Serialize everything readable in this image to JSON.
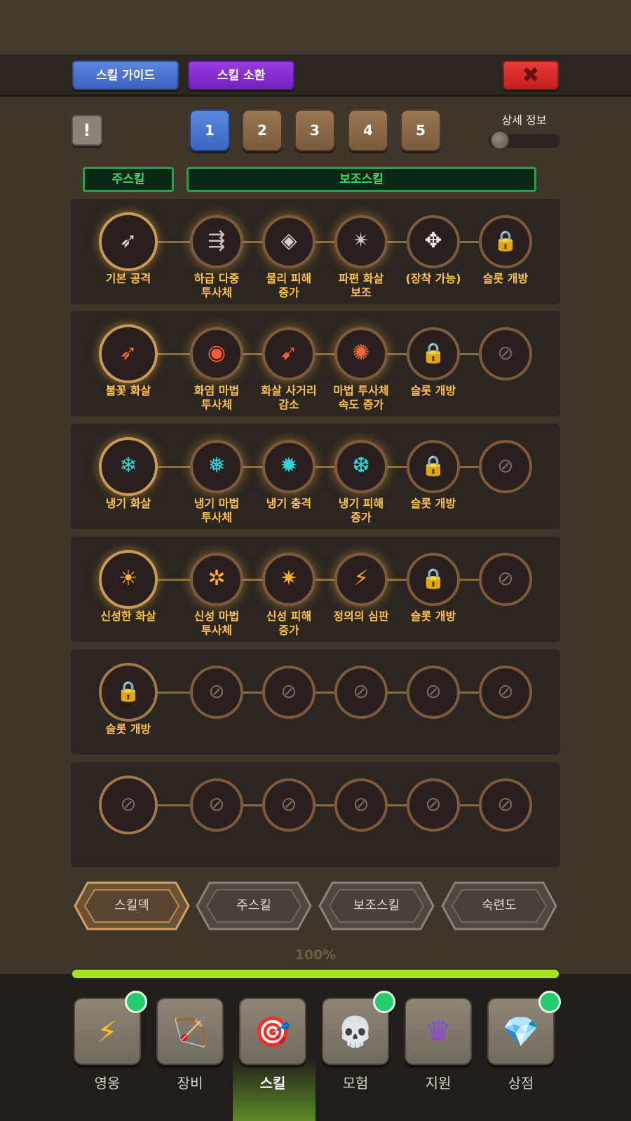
{
  "header": {
    "guide_label": "스킬 가이드",
    "summon_label": "스킬 소환",
    "close_symbol": "✖",
    "alert_symbol": "!",
    "colors": {
      "guide": "#4a75d4",
      "summon": "#8a2fd4",
      "close": "#d42828"
    }
  },
  "page_tabs": [
    "1",
    "2",
    "3",
    "4",
    "5"
  ],
  "active_page_tab": "1",
  "detail": {
    "label": "상세 정보",
    "toggle_on": false
  },
  "columns": {
    "main": "주스킬",
    "sub": "보조스킬"
  },
  "rows": [
    {
      "slots": [
        {
          "label": "기본 공격",
          "icon": "➶",
          "icon_name": "basic-arrow-icon",
          "color": "#dcd6cc"
        },
        {
          "label": "하급 다중\n투사체",
          "icon": "⇶",
          "icon_name": "multi-projectile-icon",
          "color": "#c9c2b8"
        },
        {
          "label": "물리 피해\n증가",
          "icon": "◈",
          "icon_name": "physical-damage-icon",
          "color": "#d7d0c6"
        },
        {
          "label": "파편 화살\n보조",
          "icon": "✴",
          "icon_name": "shrapnel-arrow-icon",
          "color": "#d0c9bf"
        },
        {
          "label": "(장착 가능)",
          "icon": "✥",
          "icon_name": "equip-move-icon",
          "color": "#f2ece2"
        },
        {
          "label": "슬롯 개방",
          "icon": "🔒",
          "icon_name": "lock-icon",
          "color": "#f2ece2"
        }
      ]
    },
    {
      "slots": [
        {
          "label": "불꽃 화살",
          "icon": "➶",
          "icon_name": "fire-arrow-icon",
          "color": "#ff6a3a"
        },
        {
          "label": "화염 마법\n투사체",
          "icon": "◉",
          "icon_name": "fire-magic-projectile-icon",
          "color": "#ff5a30"
        },
        {
          "label": "화살 사거리\n감소",
          "icon": "➹",
          "icon_name": "arrow-range-icon",
          "color": "#ff5a30"
        },
        {
          "label": "마법 투사체\n속도 증가",
          "icon": "✺",
          "icon_name": "magic-speed-icon",
          "color": "#ff6a3a"
        },
        {
          "label": "슬롯 개방",
          "icon": "🔒",
          "icon_name": "lock-icon",
          "color": "#f2ece2"
        },
        {
          "label": "",
          "icon": "⊘",
          "icon_name": "disabled-slot-icon",
          "color": "#806a5b"
        }
      ]
    },
    {
      "slots": [
        {
          "label": "냉기 화살",
          "icon": "❄",
          "icon_name": "frost-arrow-icon",
          "color": "#2fd6d6"
        },
        {
          "label": "냉기 마법\n투사체",
          "icon": "❅",
          "icon_name": "frost-magic-projectile-icon",
          "color": "#2fd6d6"
        },
        {
          "label": "냉기 충격",
          "icon": "✹",
          "icon_name": "frost-shock-icon",
          "color": "#2fd6d6"
        },
        {
          "label": "냉기 피해\n증가",
          "icon": "❆",
          "icon_name": "frost-damage-icon",
          "color": "#2fd6d6"
        },
        {
          "label": "슬롯 개방",
          "icon": "🔒",
          "icon_name": "lock-icon",
          "color": "#f2ece2"
        },
        {
          "label": "",
          "icon": "⊘",
          "icon_name": "disabled-slot-icon",
          "color": "#806a5b"
        }
      ]
    },
    {
      "slots": [
        {
          "label": "신성한 화살",
          "icon": "☀",
          "icon_name": "holy-arrow-icon",
          "color": "#ffb020"
        },
        {
          "label": "신성 마법\n투사체",
          "icon": "✲",
          "icon_name": "holy-magic-projectile-icon",
          "color": "#ffb020"
        },
        {
          "label": "신성 피해\n증가",
          "icon": "✷",
          "icon_name": "holy-damage-icon",
          "color": "#ffb020"
        },
        {
          "label": "정의의 심판",
          "icon": "⚡",
          "icon_name": "judgement-icon",
          "color": "#ffb020"
        },
        {
          "label": "슬롯 개방",
          "icon": "🔒",
          "icon_name": "lock-icon",
          "color": "#f2ece2"
        },
        {
          "label": "",
          "icon": "⊘",
          "icon_name": "disabled-slot-icon",
          "color": "#806a5b"
        }
      ]
    },
    {
      "slots": [
        {
          "label": "슬롯 개방",
          "icon": "🔒",
          "icon_name": "lock-icon",
          "color": "#f2ece2"
        },
        {
          "label": "",
          "icon": "⊘",
          "icon_name": "disabled-slot-icon",
          "color": "#806a5b"
        },
        {
          "label": "",
          "icon": "⊘",
          "icon_name": "disabled-slot-icon",
          "color": "#806a5b"
        },
        {
          "label": "",
          "icon": "⊘",
          "icon_name": "disabled-slot-icon",
          "color": "#806a5b"
        },
        {
          "label": "",
          "icon": "⊘",
          "icon_name": "disabled-slot-icon",
          "color": "#806a5b"
        },
        {
          "label": "",
          "icon": "⊘",
          "icon_name": "disabled-slot-icon",
          "color": "#806a5b"
        }
      ]
    },
    {
      "slots": [
        {
          "label": "",
          "icon": "⊘",
          "icon_name": "disabled-slot-icon",
          "color": "#806a5b"
        },
        {
          "label": "",
          "icon": "⊘",
          "icon_name": "disabled-slot-icon",
          "color": "#806a5b"
        },
        {
          "label": "",
          "icon": "⊘",
          "icon_name": "disabled-slot-icon",
          "color": "#806a5b"
        },
        {
          "label": "",
          "icon": "⊘",
          "icon_name": "disabled-slot-icon",
          "color": "#806a5b"
        },
        {
          "label": "",
          "icon": "⊘",
          "icon_name": "disabled-slot-icon",
          "color": "#806a5b"
        },
        {
          "label": "",
          "icon": "⊘",
          "icon_name": "disabled-slot-icon",
          "color": "#806a5b"
        }
      ]
    }
  ],
  "bottom_tabs": [
    "스킬덱",
    "주스킬",
    "보조스킬",
    "숙련도"
  ],
  "active_bottom_tab": "스킬덱",
  "progress": {
    "label": "100%",
    "value": 100,
    "color": "#a8e022"
  },
  "nav": [
    {
      "label": "영웅",
      "icon": "⚡",
      "icon_name": "lightning-icon",
      "badge": true,
      "color": "#ffc21a"
    },
    {
      "label": "장비",
      "icon": "🏹",
      "icon_name": "bow-icon",
      "badge": false,
      "color": "#c99a5a"
    },
    {
      "label": "스킬",
      "icon": "🎯",
      "icon_name": "target-icon",
      "badge": false,
      "color": "#e04a3a",
      "active": true
    },
    {
      "label": "모험",
      "icon": "💀",
      "icon_name": "skull-icon",
      "badge": true,
      "color": "#e9e2d4"
    },
    {
      "label": "지원",
      "icon": "♛",
      "icon_name": "banner-icon",
      "badge": false,
      "color": "#8a4ae0"
    },
    {
      "label": "상점",
      "icon": "💎",
      "icon_name": "treasure-chest-icon",
      "badge": true,
      "color": "#7fd6ff"
    }
  ]
}
